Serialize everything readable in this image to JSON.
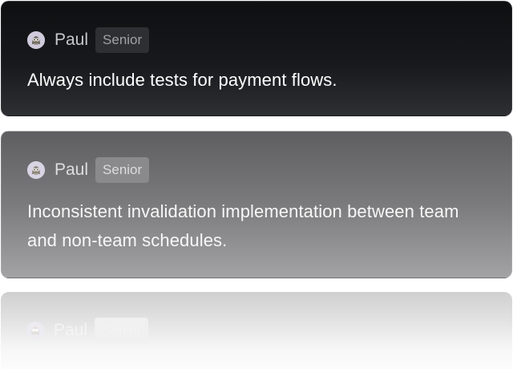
{
  "comments": [
    {
      "author": "Paul",
      "badge": "Senior",
      "avatar_icon": "owl-avatar-icon",
      "text": "Always include tests for payment flows."
    },
    {
      "author": "Paul",
      "badge": "Senior",
      "avatar_icon": "owl-avatar-icon",
      "text": "Inconsistent invalidation implementation between team and non-team schedules."
    },
    {
      "author": "Paul",
      "badge": "Senior",
      "avatar_icon": "owl-avatar-icon",
      "text": ""
    }
  ],
  "colors": {
    "card_dark": "#0e0f11",
    "card_mid": "#6c6c6e",
    "badge_bg": "#2e2f33",
    "text": "#ffffff"
  }
}
